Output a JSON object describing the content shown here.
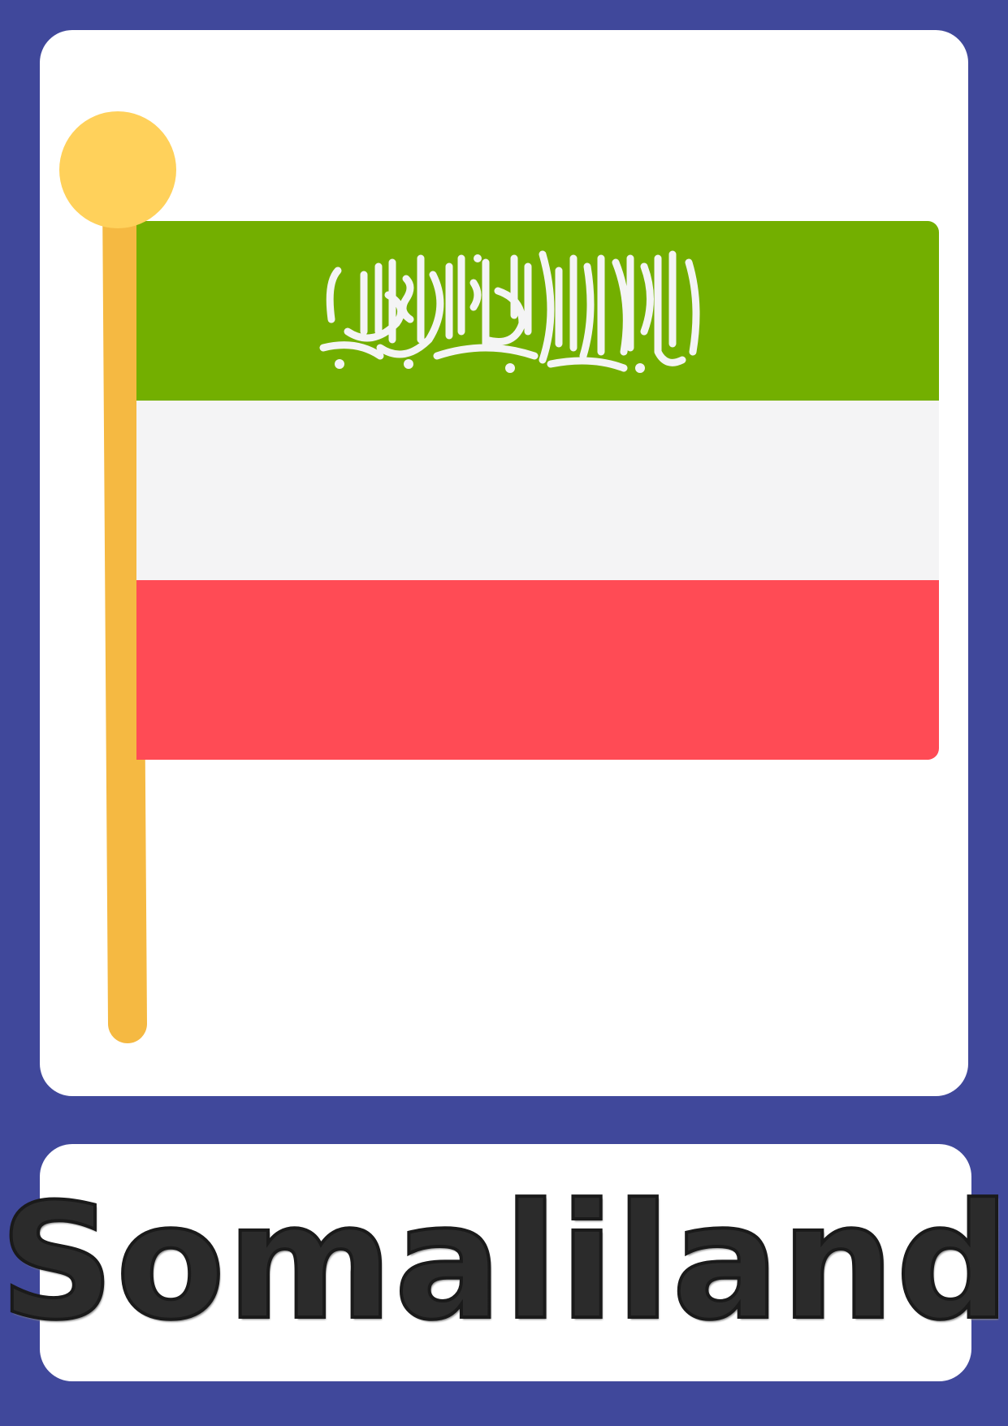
{
  "card": {
    "country_name": "Somaliland",
    "colors": {
      "border": "#40489b",
      "panel": "#ffffff",
      "pole": "#f5b942",
      "pole_finial": "#ffd15b",
      "flag_green": "#73af00",
      "flag_white": "#f4f4f5",
      "flag_red": "#ff4b55",
      "star": "#464655",
      "shahada": "#f4f4f5"
    },
    "icons": {
      "pole": "flagpole-icon",
      "finial": "flagpole-finial-icon",
      "star": "star-icon",
      "inscription": "shahada-inscription"
    }
  }
}
